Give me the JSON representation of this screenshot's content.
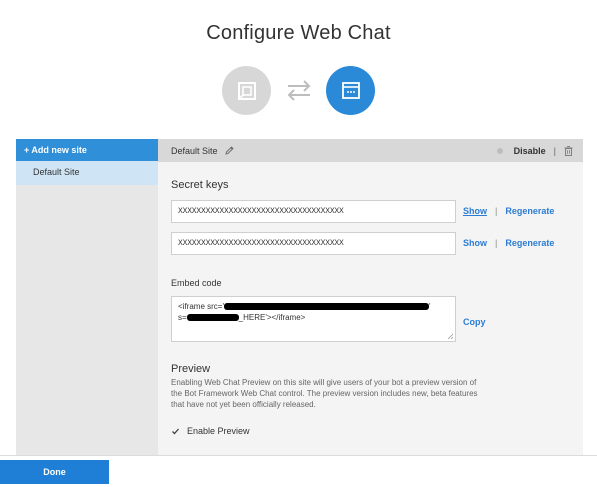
{
  "page": {
    "title": "Configure Web Chat"
  },
  "icons": {
    "left": "web-chat-inactive-icon",
    "right": "web-chat-active-icon",
    "middle": "swap-arrows-icon",
    "accent": "#2b8ad8",
    "inactive": "#d7d7d7"
  },
  "sidebar": {
    "add_label": "+ Add new site",
    "items": [
      {
        "label": "Default Site",
        "selected": true
      }
    ]
  },
  "site": {
    "name": "Default Site",
    "disable_label": "Disable",
    "secret_keys_label": "Secret keys",
    "keys": [
      {
        "value": "XXXXXXXXXXXXXXXXXXXXXXXXXXXXXXXXXXXX",
        "show_label": "Show",
        "regenerate_label": "Regenerate"
      },
      {
        "value": "XXXXXXXXXXXXXXXXXXXXXXXXXXXXXXXXXXXX",
        "show_label": "Show",
        "regenerate_label": "Regenerate"
      }
    ],
    "embed_code_label": "Embed code",
    "embed_line1_prefix": "<iframe src='",
    "embed_line1_suffix": "'",
    "embed_line2_prefix": "s=",
    "embed_line2_suffix": "_HERE'></iframe>",
    "copy_label": "Copy",
    "preview_label": "Preview",
    "preview_description": "Enabling Web Chat Preview on this site will give users of your bot a preview version of the Bot Framework Web Chat control. The preview version includes new, beta features that have not yet been officially released.",
    "enable_preview_label": "Enable Preview",
    "enable_preview_checked": true
  },
  "footer": {
    "done_label": "Done"
  }
}
